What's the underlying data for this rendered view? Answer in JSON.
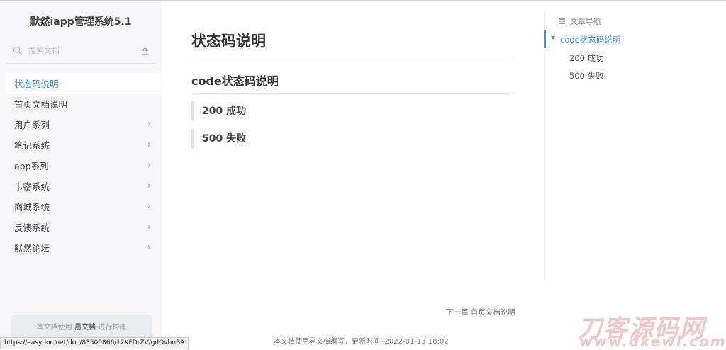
{
  "site_title": "默然iapp管理系统5.1",
  "search": {
    "placeholder": "搜索文档",
    "all_label": "全"
  },
  "nav": [
    {
      "label": "状态码说明",
      "active": true,
      "has_children": false
    },
    {
      "label": "首页文档说明",
      "active": false,
      "has_children": false
    },
    {
      "label": "用户系列",
      "active": false,
      "has_children": true
    },
    {
      "label": "笔记系统",
      "active": false,
      "has_children": true
    },
    {
      "label": "app系列",
      "active": false,
      "has_children": true
    },
    {
      "label": "卡密系统",
      "active": false,
      "has_children": true
    },
    {
      "label": "商城系统",
      "active": false,
      "has_children": true
    },
    {
      "label": "反馈系统",
      "active": false,
      "has_children": true
    },
    {
      "label": "默然论坛",
      "active": false,
      "has_children": true
    }
  ],
  "built_with": {
    "prefix": "本文档使用",
    "brand": "易文档",
    "suffix": "进行构建"
  },
  "status_url": "https://easydoc.net/doc/83500866/12KFDrZV/gdOvbnBA",
  "article": {
    "title": "状态码说明",
    "subtitle": "code状态码说明",
    "codes": [
      "200 成功",
      "500 失败"
    ]
  },
  "toc": {
    "heading": "文章导航",
    "items": [
      {
        "label": "code状态码说明",
        "level": 1,
        "active": true
      },
      {
        "label": "200 成功",
        "level": 2,
        "active": false
      },
      {
        "label": "500 失败",
        "level": 2,
        "active": false
      }
    ]
  },
  "next": {
    "prefix": "下一篇",
    "title": "首页文档说明"
  },
  "footer": "本文档使用易文档编写，更新时间: 2022-01-13 18:02",
  "watermark": {
    "text": "刀客源码网",
    "url": "www.dkewl.com"
  },
  "colors": {
    "accent": "#3f8ee0",
    "sidebar_bg": "#f7f7f9"
  }
}
